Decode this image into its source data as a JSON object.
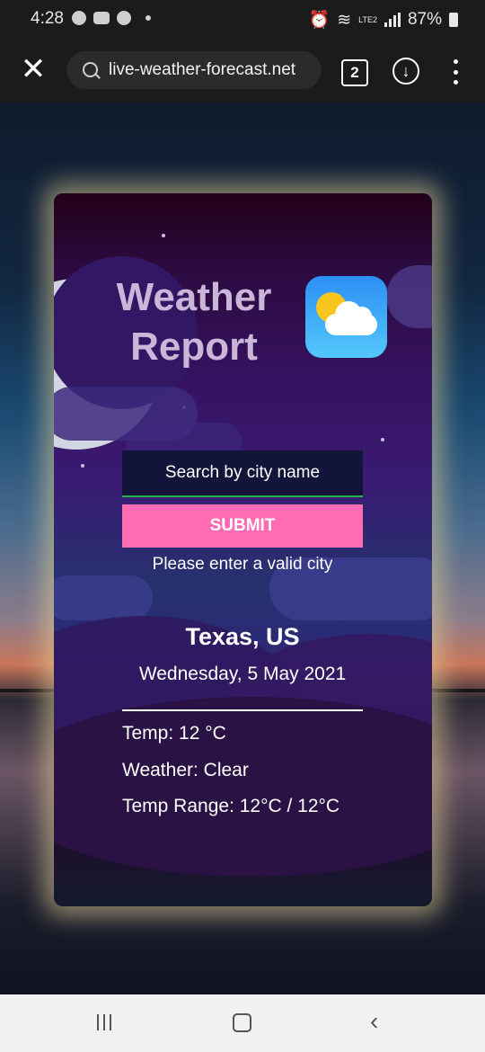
{
  "status_bar": {
    "time": "4:28",
    "battery": "87%",
    "network": "LTE2"
  },
  "browser": {
    "url": "live-weather-forecast.net",
    "tab_count": "2"
  },
  "weather_card": {
    "title_line1": "Weather",
    "title_line2": "Report",
    "search_placeholder": "Search by city name",
    "submit_label": "SUBMIT",
    "error_message": "Please enter a valid city",
    "location": "Texas, US",
    "date": "Wednesday, 5 May 2021",
    "temp": "Temp: 12 °C",
    "weather": "Weather: Clear",
    "temp_range": "Temp Range: 12°C / 12°C"
  },
  "colors": {
    "submit_button": "#ff6cb4",
    "input_underline": "#22b24c",
    "title_text": "#c9b6d8"
  }
}
